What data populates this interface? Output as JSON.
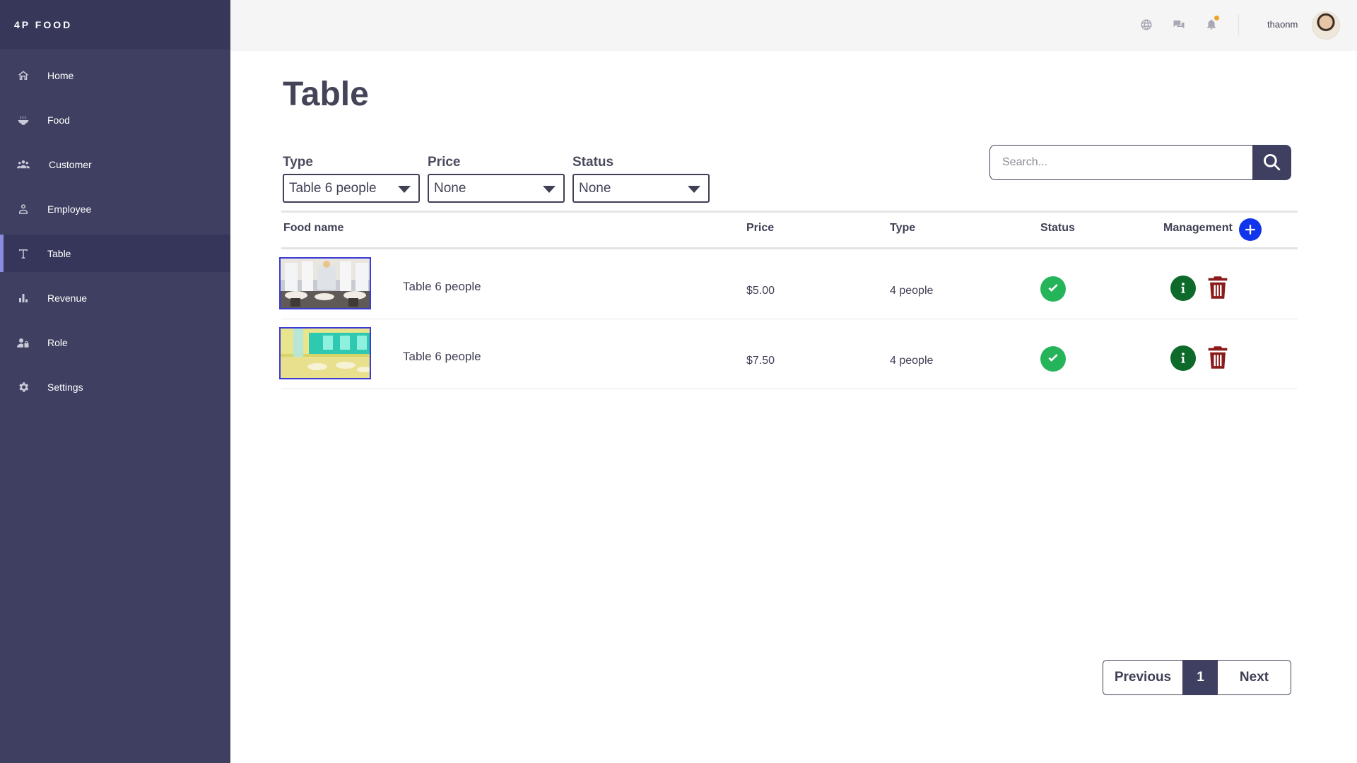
{
  "brand": "4P FOOD",
  "sidebar": {
    "items": [
      {
        "label": "Home",
        "icon": "home-icon",
        "active": false
      },
      {
        "label": "Food",
        "icon": "food-bowl-icon",
        "active": false
      },
      {
        "label": "Customer",
        "icon": "users-icon",
        "active": false
      },
      {
        "label": "Employee",
        "icon": "user-icon",
        "active": false
      },
      {
        "label": "Table",
        "icon": "text-t-icon",
        "active": true
      },
      {
        "label": "Revenue",
        "icon": "bar-chart-icon",
        "active": false
      },
      {
        "label": "Role",
        "icon": "user-lock-icon",
        "active": false
      },
      {
        "label": "Settings",
        "icon": "gear-icon",
        "active": false
      }
    ]
  },
  "topbar": {
    "icons": [
      "globe-icon",
      "chat-icon",
      "bell-icon"
    ],
    "notification_color": "#f1a22a",
    "username": "thaonm"
  },
  "page": {
    "title": "Table"
  },
  "filters": {
    "type": {
      "label": "Type",
      "value": "Table 6 people"
    },
    "price": {
      "label": "Price",
      "value": "None"
    },
    "status": {
      "label": "Status",
      "value": "None"
    }
  },
  "search": {
    "placeholder": "Search..."
  },
  "table": {
    "headers": {
      "name": "Food name",
      "price": "Price",
      "type": "Type",
      "status": "Status",
      "management": "Management"
    },
    "rows": [
      {
        "name": "Table 6 people",
        "price": "$5.00",
        "type": "4 people",
        "status": "available"
      },
      {
        "name": "Table 6 people",
        "price": "$7.50",
        "type": "4 people",
        "status": "available"
      }
    ]
  },
  "pagination": {
    "previous": "Previous",
    "current": "1",
    "next": "Next"
  },
  "colors": {
    "sidebar_bg": "#3f3f62",
    "add_button": "#1035ea",
    "status_ok": "#26b45a",
    "info_button": "#0e6a2a",
    "delete_button": "#8b1a1a"
  }
}
